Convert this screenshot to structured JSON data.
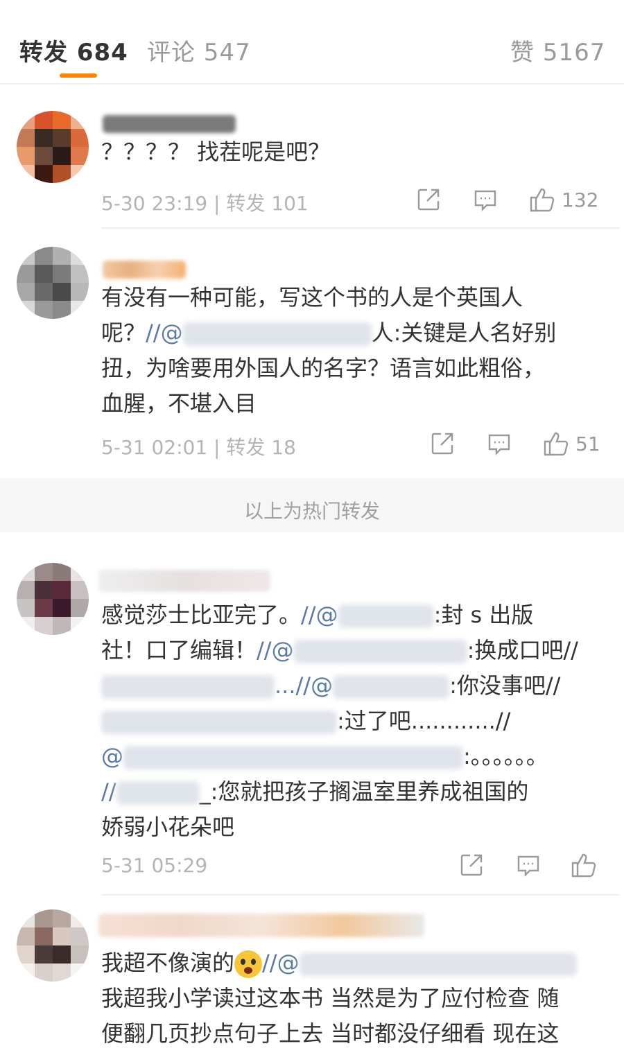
{
  "tabs": {
    "reposts": "转发 684",
    "comments": "评论 547",
    "likes": "赞 5167"
  },
  "accent_color": "#ff8200",
  "hot_section_label": "以上为热门转发",
  "posts": [
    {
      "text_lines": [
        "？？？？ 找茬呢是吧？"
      ],
      "meta": "5-30 23:19 | 转发 101",
      "like_count": "132"
    },
    {
      "text_lines": [
        "有没有一种可能，写这个书的人是个英国人",
        "人:关键是人名好别",
        "扭，为啥要用外国人的名字？语言如此粗俗，",
        "血腥，不堪入目"
      ],
      "meta": "5-31 02:01 | 转发 18",
      "like_count": "51",
      "fragments": {
        "ma": "呢？",
        "mb": "//@"
      }
    },
    {
      "text_lines": [
        "感觉莎士比亚完了。",
        ":封 s 出版",
        "社！口了编辑！",
        ":换成口吧//",
        ":你没事吧//",
        ":过了吧............//",
        ":。。。。。。",
        ":您就把孩子搁温室里养成祖国的",
        "娇弱小花朵吧"
      ],
      "meta": "5-31 05:29",
      "like_count": "",
      "fragments": {
        "m1": "//@",
        "m2": "//@",
        "m3": "...//@",
        "m4": "@",
        "m5": "@",
        "m6": "//",
        "m7": "_"
      }
    },
    {
      "text_lines": [
        "我超不像演的",
        "我超我小学读过这本书 当然是为了应付检查 随",
        "便翻几页抄点句子上去 当时都没仔细看 现在这"
      ],
      "fragments": {
        "m8": "//@"
      },
      "emoji": "scream-emoji"
    }
  ],
  "icons": [
    "repost-icon",
    "comment-icon",
    "like-icon"
  ]
}
